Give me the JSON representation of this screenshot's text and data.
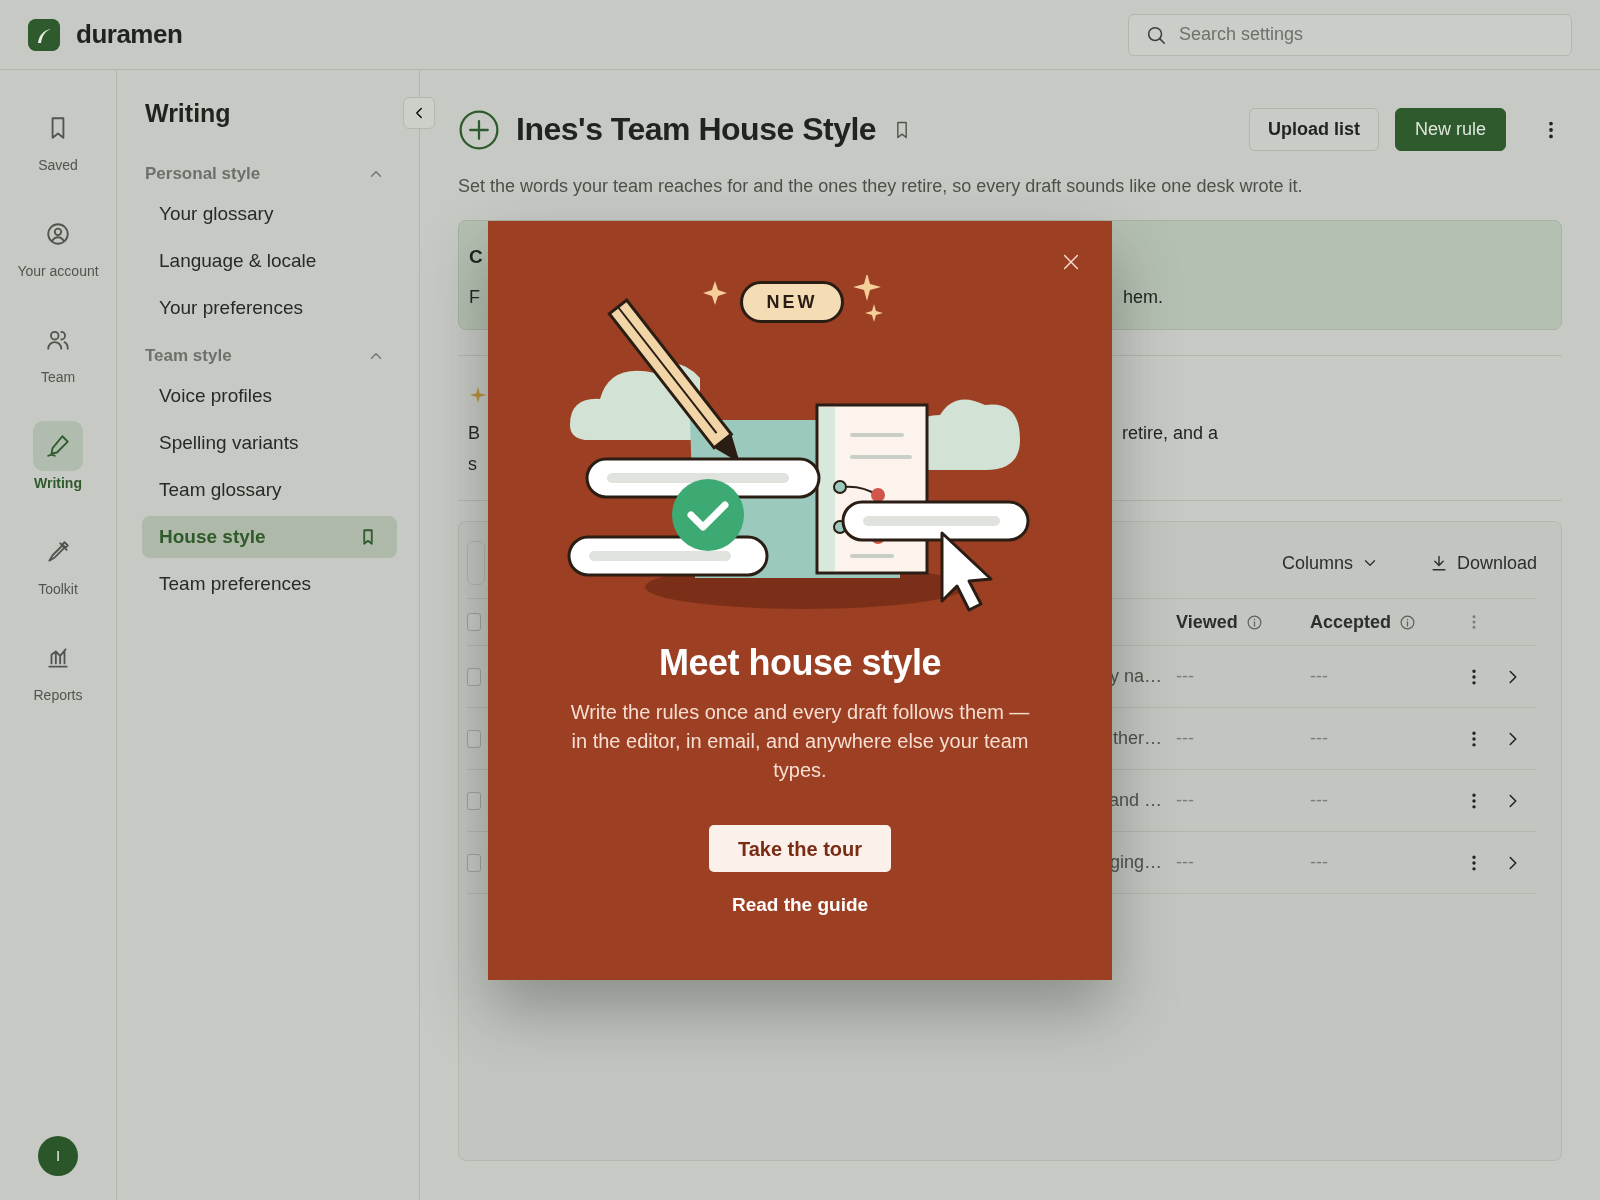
{
  "app": {
    "name": "duramen"
  },
  "search": {
    "placeholder": "Search settings"
  },
  "rail": {
    "items": [
      {
        "label": "Saved",
        "selected": false
      },
      {
        "label": "Your account",
        "selected": false
      },
      {
        "label": "Team",
        "selected": false
      },
      {
        "label": "Writing",
        "selected": true
      },
      {
        "label": "Toolkit",
        "selected": false
      },
      {
        "label": "Reports",
        "selected": false
      }
    ],
    "avatar": "I"
  },
  "sidebar": {
    "title": "Writing",
    "sections": [
      {
        "label": "Personal style",
        "expanded": true,
        "items": [
          {
            "label": "Your glossary",
            "selected": false
          },
          {
            "label": "Language & locale",
            "selected": false
          },
          {
            "label": "Your preferences",
            "selected": false
          }
        ]
      },
      {
        "label": "Team style",
        "expanded": true,
        "items": [
          {
            "label": "Voice profiles",
            "selected": false
          },
          {
            "label": "Spelling variants",
            "selected": false
          },
          {
            "label": "Team glossary",
            "selected": false
          },
          {
            "label": "House style",
            "selected": true
          },
          {
            "label": "Team preferences",
            "selected": false
          }
        ]
      }
    ]
  },
  "page": {
    "title": "Ines's Team House Style",
    "subtitle": "Set the words your team reaches for and the ones they retire, so every draft sounds like one desk wrote it.",
    "buttons": [
      {
        "label": "Upload list",
        "kind": "secondary"
      },
      {
        "label": "New rule",
        "kind": "primary"
      }
    ]
  },
  "banner": {
    "title_visible": "C",
    "body_visible_start": "F",
    "body_visible_end": "hem."
  },
  "intro": {
    "line1_start": "B",
    "line1_end": "retire, and a",
    "line2_start": "s"
  },
  "table": {
    "toolbar": [
      "Columns",
      "Download"
    ],
    "select_all": {
      "checked": false
    },
    "columns": [
      {
        "label": "Viewed"
      },
      {
        "label": "Accepted"
      }
    ],
    "rows": [
      {
        "checked": false,
        "name_visible": "y na…",
        "viewed": "---",
        "accepted": "---"
      },
      {
        "checked": false,
        "name_visible": "ther…",
        "viewed": "---",
        "accepted": "---"
      },
      {
        "checked": false,
        "name_visible": "and …",
        "viewed": "---",
        "accepted": "---"
      },
      {
        "checked": false,
        "name_visible": "ging…",
        "viewed": "---",
        "accepted": "---"
      }
    ]
  },
  "dialog": {
    "badge": "NEW",
    "title": "Meet house style",
    "body": "Write the rules once and every draft follows them — in the editor, in email, and anywhere else your team types.",
    "primary": "Take the tour",
    "link": "Read the guide"
  }
}
